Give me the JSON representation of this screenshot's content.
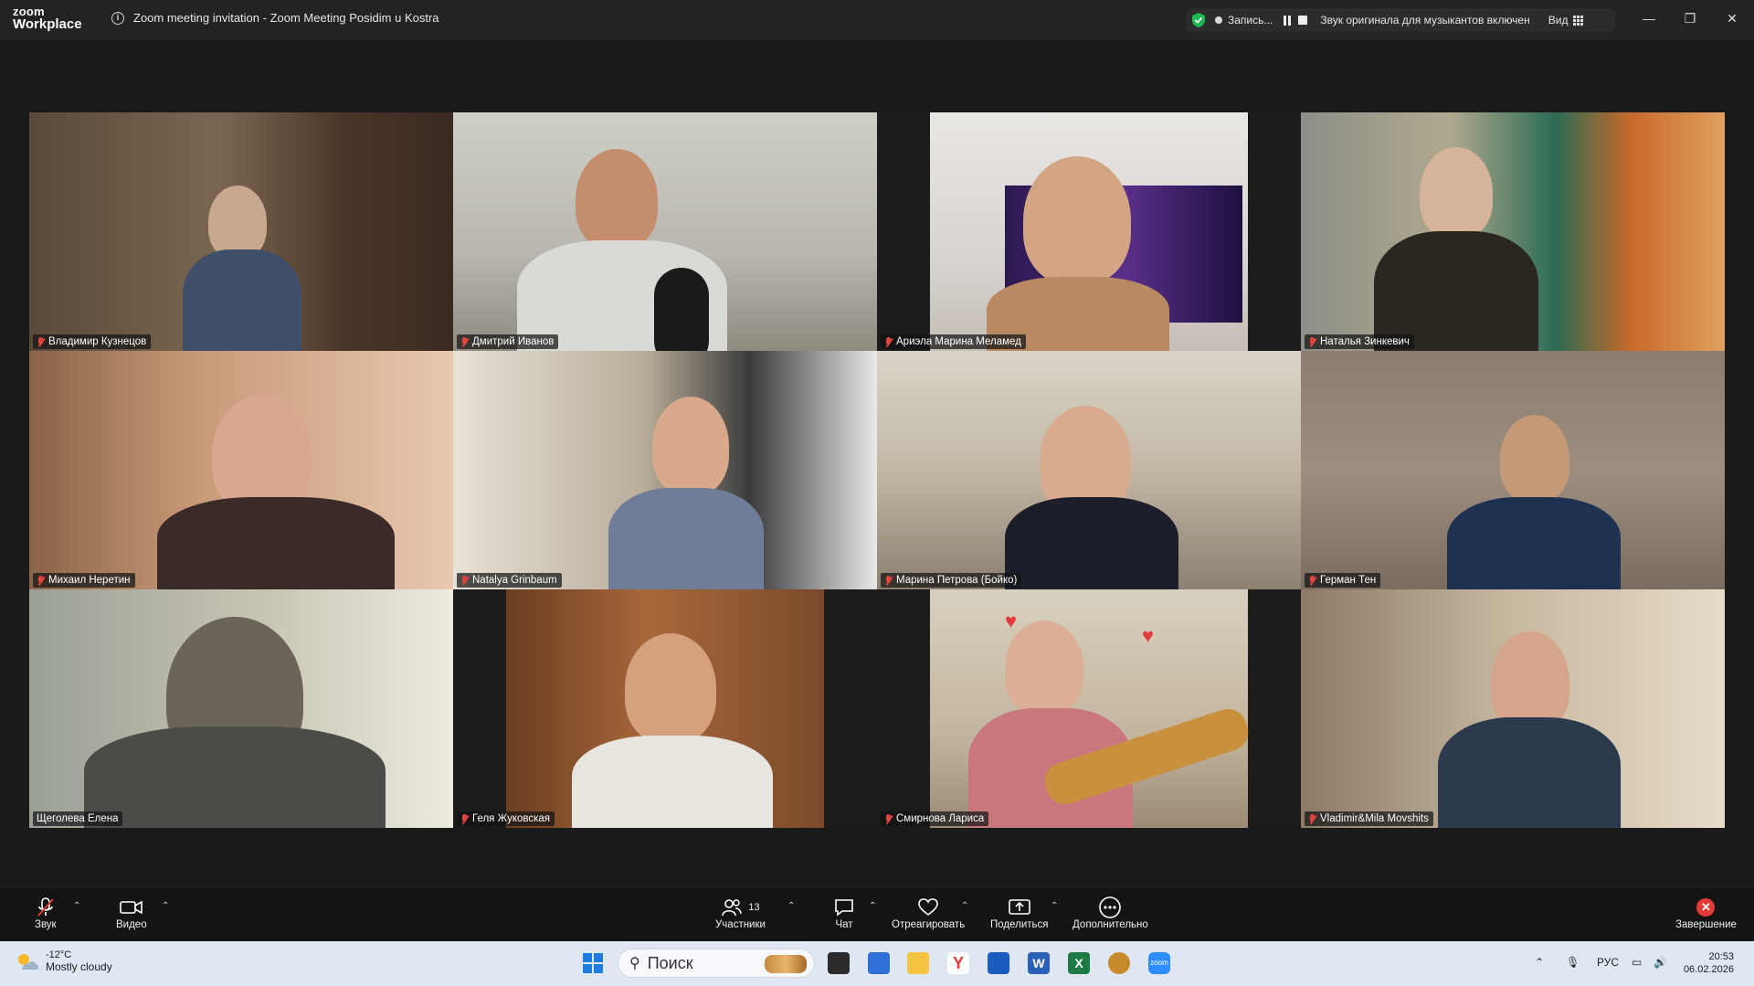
{
  "app": {
    "logo_line1": "zoom",
    "logo_line2": "Workplace"
  },
  "window": {
    "title": "Zoom meeting invitation - Zoom Meeting Posidim u Kostra"
  },
  "status": {
    "recording_label": "Запись...",
    "original_sound": "Звук оригинала для музыкантов включен",
    "view_label": "Вид"
  },
  "participants": [
    {
      "name": "Владимир Кузнецов",
      "muted": true
    },
    {
      "name": "Дмитрий Иванов",
      "muted": true
    },
    {
      "name": "Ариэла Марина Меламед",
      "muted": true
    },
    {
      "name": "Наталья Зинкевич",
      "muted": true
    },
    {
      "name": "Михаил Неретин",
      "muted": true
    },
    {
      "name": "Natalya Grinbaum",
      "muted": true
    },
    {
      "name": "Марина Петрова (Бойко)",
      "muted": true
    },
    {
      "name": "Герман Тен",
      "muted": true
    },
    {
      "name": "Щеголева Елена",
      "muted": false,
      "active_speaker": true
    },
    {
      "name": "Геля Жуковская",
      "muted": true
    },
    {
      "name": "Смирнова Лариса",
      "muted": true
    },
    {
      "name": "Vladimir&Mila Movshits",
      "muted": true
    }
  ],
  "toolbar": {
    "audio": "Звук",
    "video": "Видео",
    "participants": "Участники",
    "participants_count": "13",
    "chat": "Чат",
    "react": "Отреагировать",
    "share": "Поделиться",
    "more": "Дополнительно",
    "end": "Завершение"
  },
  "taskbar": {
    "temperature": "-12°C",
    "weather": "Mostly cloudy",
    "search_placeholder": "Поиск",
    "language": "РУС",
    "time": "20:53",
    "date": "06.02.2026"
  },
  "colors": {
    "active_speaker_border": "#26d07c",
    "mute_red": "#e0443d",
    "end_red": "#e53935",
    "shield_green": "#1db954"
  }
}
